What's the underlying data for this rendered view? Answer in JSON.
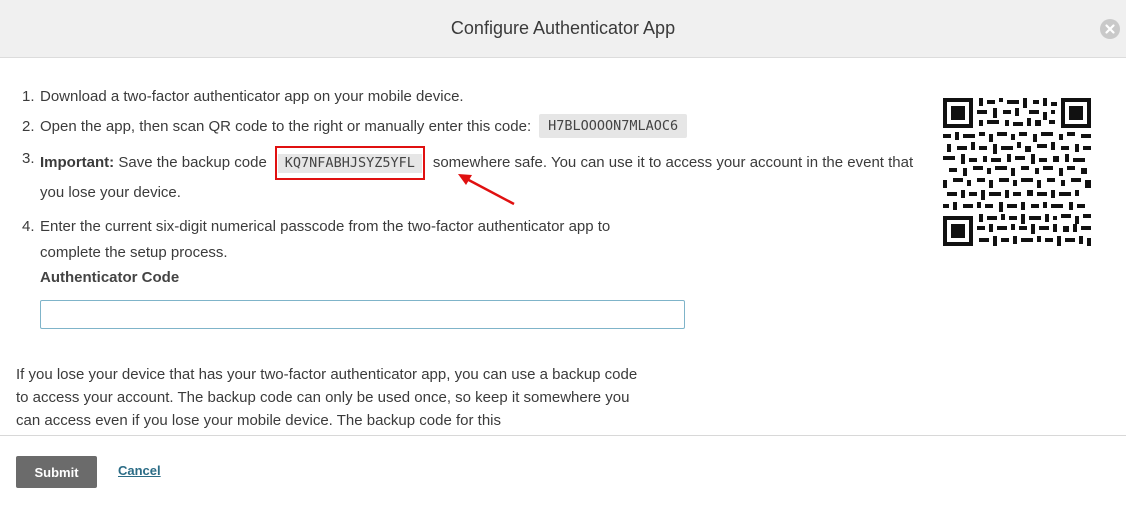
{
  "dialog": {
    "title": "Configure Authenticator App"
  },
  "steps": [
    {
      "num": "1.",
      "text": "Download a two-factor authenticator app on your mobile device."
    },
    {
      "num": "2.",
      "text": "Open the app, then scan QR code to the right or manually enter this code:",
      "code": "H7BLOOOON7MLAOC6"
    },
    {
      "num": "3.",
      "label": "Important:",
      "text_before": "Save the backup code",
      "code": "KQ7NFABHJSYZ5YFL",
      "text_after": "somewhere safe. You can use it to access your account in the event that you lose your device."
    },
    {
      "num": "4.",
      "text": "Enter the current six-digit numerical passcode from the two-factor authenticator app to complete the setup process."
    }
  ],
  "form": {
    "label": "Authenticator Code",
    "value": ""
  },
  "info": {
    "text": "If you lose your device that has your two-factor authenticator app, you can use a backup code to access your account. The backup code can only be used once, so keep it somewhere you can access even if you lose your mobile device. The backup code for this"
  },
  "footer": {
    "submit_label": "Submit",
    "cancel_label": "Cancel"
  },
  "colors": {
    "highlight": "#e01010",
    "link": "#2b6c86",
    "submit_bg": "#6b6b6b",
    "header_bg": "#f0f0f0"
  }
}
